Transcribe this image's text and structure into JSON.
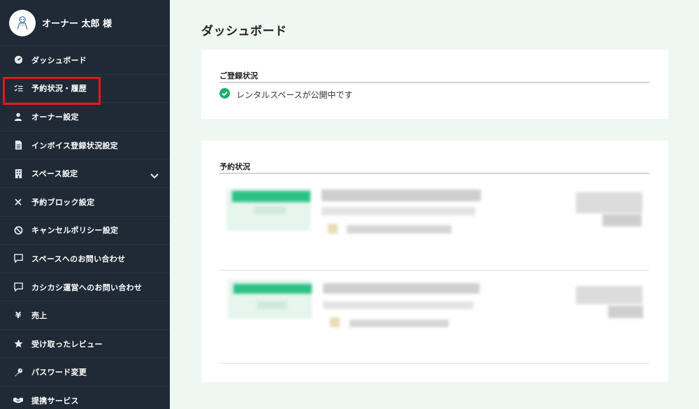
{
  "user": {
    "name": "オーナー 太郎 様"
  },
  "sidebar": {
    "items": [
      {
        "label": "ダッシュボード",
        "icon": "dashboard-icon"
      },
      {
        "label": "予約状況・履歴",
        "icon": "checklist-icon"
      },
      {
        "label": "オーナー設定",
        "icon": "person-icon"
      },
      {
        "label": "インボイス登録状況設定",
        "icon": "document-icon"
      },
      {
        "label": "スペース設定",
        "icon": "building-icon"
      },
      {
        "label": "予約ブロック設定",
        "icon": "close-icon"
      },
      {
        "label": "キャンセルポリシー設定",
        "icon": "ban-icon"
      },
      {
        "label": "スペースへのお問い合わせ",
        "icon": "chat-icon"
      },
      {
        "label": "カシカシ運営へのお問い合わせ",
        "icon": "chat-icon"
      },
      {
        "label": "売上",
        "icon": "yen-icon"
      },
      {
        "label": "受け取ったレビュー",
        "icon": "star-icon"
      },
      {
        "label": "パスワード変更",
        "icon": "key-icon"
      },
      {
        "label": "提携サービス",
        "icon": "handshake-icon"
      }
    ]
  },
  "main": {
    "title": "ダッシュボード",
    "registration": {
      "title": "ご登録状況",
      "status": "レンタルスペースが公開中です"
    },
    "reservations": {
      "title": "予約状況"
    }
  },
  "colors": {
    "sidebar_bg": "#1f2a36",
    "accent_green": "#1aae6f",
    "highlight_red": "#e8161b",
    "page_bg": "#eff7f3"
  }
}
